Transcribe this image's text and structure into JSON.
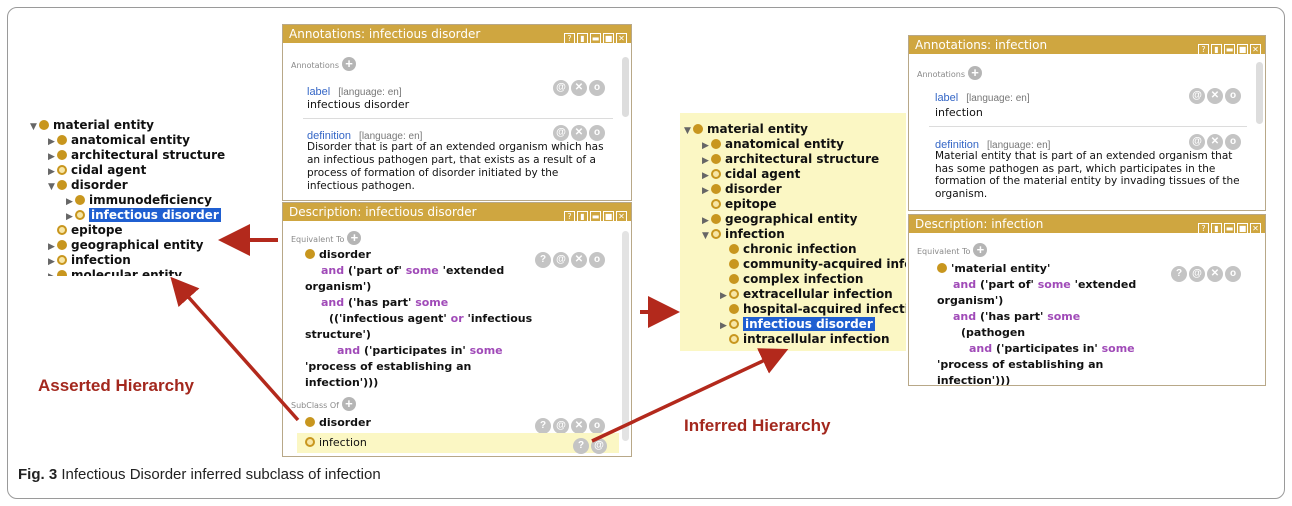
{
  "asserted_tree": {
    "items": [
      {
        "twisty": "▼",
        "dot": "solid",
        "label": "material entity",
        "selected": false
      },
      {
        "twisty": "▶",
        "dot": "solid",
        "label": "anatomical entity",
        "selected": false
      },
      {
        "twisty": "▶",
        "dot": "solid",
        "label": "architectural structure",
        "selected": false
      },
      {
        "twisty": "▶",
        "dot": "ring",
        "label": "cidal agent",
        "selected": false
      },
      {
        "twisty": "▼",
        "dot": "solid",
        "label": "disorder",
        "selected": false
      },
      {
        "twisty": "▶",
        "dot": "solid",
        "label": "immunodeficiency",
        "selected": false
      },
      {
        "twisty": "▶",
        "dot": "ring",
        "label": "infectious disorder",
        "selected": true
      },
      {
        "twisty": "",
        "dot": "ring",
        "label": "epitope",
        "selected": false
      },
      {
        "twisty": "▶",
        "dot": "solid",
        "label": "geographical entity",
        "selected": false
      },
      {
        "twisty": "▶",
        "dot": "ring",
        "label": "infection",
        "selected": false
      },
      {
        "twisty": "▶",
        "dot": "solid",
        "label": "molecular entity",
        "selected": false
      }
    ]
  },
  "inferred_tree": {
    "items": [
      {
        "twisty": "▼",
        "dot": "solid",
        "label": "material entity",
        "selected": false
      },
      {
        "twisty": "▶",
        "dot": "solid",
        "label": "anatomical entity",
        "selected": false
      },
      {
        "twisty": "▶",
        "dot": "solid",
        "label": "architectural structure",
        "selected": false
      },
      {
        "twisty": "▶",
        "dot": "ring",
        "label": "cidal agent",
        "selected": false
      },
      {
        "twisty": "▶",
        "dot": "solid",
        "label": "disorder",
        "selected": false
      },
      {
        "twisty": "",
        "dot": "ring",
        "label": "epitope",
        "selected": false
      },
      {
        "twisty": "▶",
        "dot": "solid",
        "label": "geographical entity",
        "selected": false
      },
      {
        "twisty": "▼",
        "dot": "ring",
        "label": "infection",
        "selected": false
      },
      {
        "twisty": "",
        "dot": "solid",
        "label": "chronic infection",
        "selected": false
      },
      {
        "twisty": "",
        "dot": "solid",
        "label": "community-acquired infec",
        "selected": false
      },
      {
        "twisty": "",
        "dot": "solid",
        "label": "complex infection",
        "selected": false
      },
      {
        "twisty": "▶",
        "dot": "ring",
        "label": "extracellular infection",
        "selected": false
      },
      {
        "twisty": "",
        "dot": "solid",
        "label": "hospital-acquired infectio",
        "selected": false
      },
      {
        "twisty": "▶",
        "dot": "ring",
        "label": "infectious disorder",
        "selected": true
      },
      {
        "twisty": "",
        "dot": "ring",
        "label": "intracellular infection",
        "selected": false
      }
    ]
  },
  "left_annotations": {
    "title": "Annotations: infectious disorder",
    "section": "Annotations",
    "label_key": "label",
    "label_lang": "[language: en]",
    "label_value": "infectious disorder",
    "def_key": "definition",
    "def_lang": "[language: en]",
    "def_lines": [
      "Disorder that is part of an extended organism which has",
      "an infectious pathogen part, that exists as a result of a",
      "process of formation of disorder initiated by the",
      "infectious pathogen."
    ]
  },
  "left_description": {
    "title": "Description: infectious disorder",
    "equiv_section": "Equivalent To",
    "subclass_section": "SubClass Of",
    "subclass_items": [
      "disorder",
      "infection"
    ]
  },
  "right_annotations": {
    "title": "Annotations: infection",
    "section": "Annotations",
    "label_key": "label",
    "label_lang": "[language: en]",
    "label_value": "infection",
    "def_key": "definition",
    "def_lang": "[language: en]",
    "def_lines": [
      "Material entity that is part of an extended organism that",
      "has some pathogen as part, which participates in the",
      "formation of the material entity by invading tissues of the",
      "organism."
    ]
  },
  "right_description": {
    "title": "Description: infection",
    "equiv_section": "Equivalent To"
  },
  "labels": {
    "asserted": "Asserted Hierarchy",
    "inferred": "Inferred Hierarchy",
    "caption_prefix": "Fig. 3",
    "caption_text": " Infectious Disorder inferred subclass of infection"
  },
  "colors": {
    "arrow": "#b3291c",
    "title_bar": "#cfa640",
    "tree_bg": "#fbf7c4",
    "selection": "#1f5fd1"
  }
}
